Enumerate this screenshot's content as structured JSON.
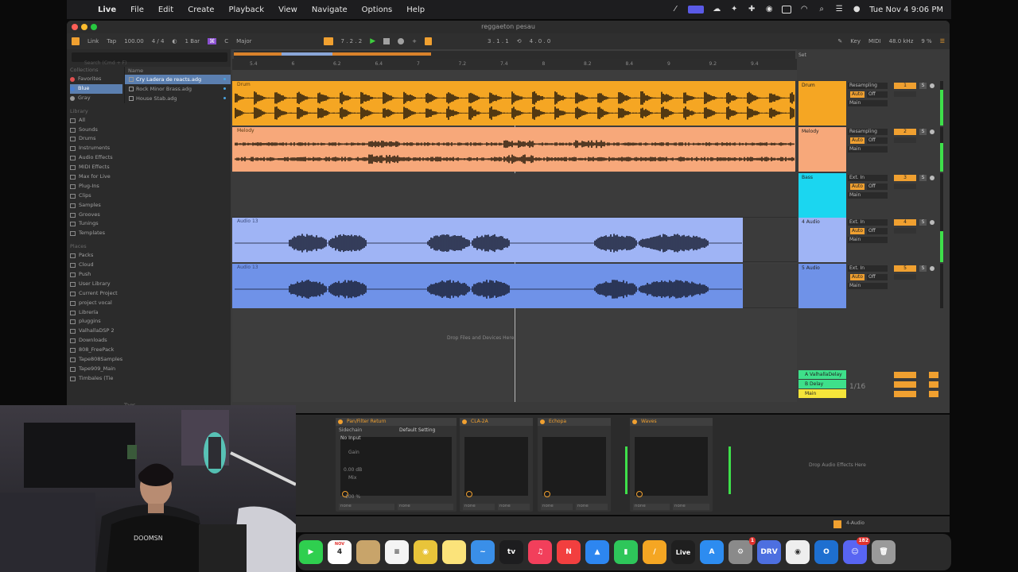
{
  "menubar": {
    "apple": "",
    "items": [
      "Live",
      "File",
      "Edit",
      "Create",
      "Playback",
      "View",
      "Navigate",
      "Options",
      "Help"
    ],
    "clock": "Tue Nov 4  9:06 PM"
  },
  "window": {
    "title": "reggaeton pesau"
  },
  "controlbar": {
    "link": "Link",
    "tap": "Tap",
    "tempo": "100.00",
    "signature": "4 / 4",
    "quantize": "1 Bar",
    "key": "C",
    "scale": "Major",
    "position": "7 . 2 . 2",
    "loop_start": "3 . 1 . 1",
    "loop_length": "4 . 0 . 0",
    "key_label": "Key",
    "midi_label": "MIDI",
    "sample_rate": "48.0 kHz",
    "cpu": "9 %"
  },
  "browser": {
    "search_placeholder": "Search (Cmd + F)",
    "collections_header": "Collections",
    "collections": [
      {
        "label": "Favorites",
        "color": "#e05050"
      },
      {
        "label": "Blue",
        "color": "#4a7fd0",
        "selected": true
      },
      {
        "label": "Gray",
        "color": "#9a9a9a"
      }
    ],
    "library_header": "Library",
    "library": [
      "All",
      "Sounds",
      "Drums",
      "Instruments",
      "Audio Effects",
      "MIDI Effects",
      "Max for Live",
      "Plug-Ins",
      "Clips",
      "Samples",
      "Grooves",
      "Tunings",
      "Templates"
    ],
    "places_header": "Places",
    "places": [
      "Packs",
      "Cloud",
      "Push",
      "User Library",
      "Current Project",
      "project vocal",
      "Librería",
      "pluggins",
      "ValhallaDSP 2",
      "Downloads",
      "808_FreePack",
      "Tape808Samples",
      "Tape909_Main",
      "Timbales (Tie"
    ],
    "name_header": "Name",
    "files": [
      {
        "label": "Cry Ladera de reacts.adg",
        "selected": true
      },
      {
        "label": "Rock Minor Brass.adg",
        "selected": false
      },
      {
        "label": "House Stab.adg",
        "selected": false
      }
    ],
    "tags_label": "Tags"
  },
  "ruler": [
    "5.4",
    "6",
    "6.2",
    "6.4",
    "7",
    "7.2",
    "7.4",
    "8",
    "8.2",
    "8.4",
    "9",
    "9.2",
    "9.4"
  ],
  "tracks": [
    {
      "name": "Drum",
      "clip_name": "Drum",
      "color": "#f5a623",
      "input": "Resampling",
      "output": "Main",
      "number": "1",
      "meter_level": 0.8
    },
    {
      "name": "Melody",
      "clip_name": "Melody",
      "color": "#f7a87a",
      "input": "Resampling",
      "output": "Main",
      "number": "2",
      "meter_level": 0.65
    },
    {
      "name": "Bass",
      "clip_name": "",
      "color": "#1bd6f0",
      "input": "Ext. In",
      "output": "Main",
      "number": "3",
      "meter_level": 0
    },
    {
      "name": "4 Audio",
      "clip_name": "Audio 13",
      "color": "#9fb4f5",
      "input": "Ext. In",
      "output": "Main",
      "number": "4",
      "meter_level": 0.7
    },
    {
      "name": "5 Audio",
      "clip_name": "Audio 13",
      "color": "#6f92e8",
      "input": "Ext. In",
      "output": "Main",
      "number": "5",
      "meter_level": 0
    }
  ],
  "drop_area": "Drop Files and Devices Here",
  "returns": [
    {
      "name": "A ValhallaDelay",
      "color": "#3ee08a"
    },
    {
      "name": "B Delay",
      "color": "#3ee08a"
    },
    {
      "name": "Main",
      "color": "#f5e53a"
    }
  ],
  "scale_label": "1/16",
  "devices": [
    {
      "title": "Setting",
      "preset": "",
      "width": 44
    },
    {
      "title": "Pan/Filter Return",
      "preset": "Sidechain",
      "width": 152
    },
    {
      "title": "CLA-2A",
      "preset": "",
      "width": 92
    },
    {
      "title": "Echopa",
      "preset": "",
      "width": 92
    },
    {
      "title": "Waves",
      "preset": "",
      "width": 104
    }
  ],
  "device_labels": {
    "no_input": "No Input",
    "gain": "Gain",
    "gain_value": "0.00 dB",
    "mix": "Mix",
    "mix_value": "100 %",
    "default_setting": "Default Setting",
    "none": "none"
  },
  "drop_effects": "Drop Audio Effects Here",
  "status_target": "4-Audio",
  "dock": [
    {
      "name": "FaceTime",
      "color": "#2fcf4f",
      "glyph": "▶"
    },
    {
      "name": "Calendar",
      "color": "#ffffff",
      "glyph": "4"
    },
    {
      "name": "Photos",
      "color": "#c8a46a",
      "glyph": ""
    },
    {
      "name": "Reminders",
      "color": "#f4f4f4",
      "glyph": "≡"
    },
    {
      "name": "Chrome",
      "color": "#e8c43a",
      "glyph": "◉"
    },
    {
      "name": "Notes",
      "color": "#fbe37a",
      "glyph": ""
    },
    {
      "name": "Freeform",
      "color": "#3a8fe8",
      "glyph": "~"
    },
    {
      "name": "Apple TV",
      "color": "#1d1d1f",
      "glyph": "tv"
    },
    {
      "name": "Music",
      "color": "#f23f5b",
      "glyph": "♫"
    },
    {
      "name": "News",
      "color": "#f23f3f",
      "glyph": "N"
    },
    {
      "name": "Keynote",
      "color": "#2d86f0",
      "glyph": "▲"
    },
    {
      "name": "Numbers",
      "color": "#2ec65a",
      "glyph": "▮"
    },
    {
      "name": "Pages",
      "color": "#f5a623",
      "glyph": "/"
    },
    {
      "name": "Live",
      "color": "#1f1f1f",
      "glyph": "Live"
    },
    {
      "name": "App Store",
      "color": "#2d8cf0",
      "glyph": "A"
    },
    {
      "name": "System Settings",
      "color": "#8a8a8a",
      "glyph": "⚙"
    },
    {
      "name": "Drive",
      "color": "#4d6fe0",
      "glyph": "DRV"
    },
    {
      "name": "Chrome 2",
      "color": "#eeeeee",
      "glyph": "◉"
    },
    {
      "name": "Outlook",
      "color": "#1e6fd0",
      "glyph": "O"
    },
    {
      "name": "Discord",
      "color": "#5865f2",
      "glyph": "☺"
    },
    {
      "name": "Trash",
      "color": "#9a9a9a",
      "glyph": "🗑"
    }
  ],
  "calendar_badge": "NOV",
  "settings_badge": "1",
  "discord_badge": "182"
}
